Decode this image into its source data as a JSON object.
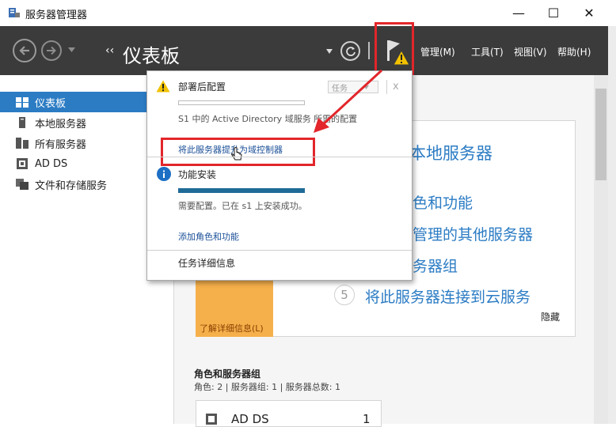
{
  "window": {
    "title": "服务器管理器",
    "controls": {
      "minimize": "—",
      "maximize": "☐",
      "close": "✕"
    }
  },
  "header": {
    "title": "仪表板",
    "breadcrumb_prefix": "‹‹",
    "menus": [
      "管理(M)",
      "工具(T)",
      "视图(V)",
      "帮助(H)"
    ]
  },
  "sidebar": {
    "items": [
      {
        "label": "仪表板",
        "icon": "dashboard-icon",
        "selected": true
      },
      {
        "label": "本地服务器",
        "icon": "server-icon"
      },
      {
        "label": "所有服务器",
        "icon": "servers-icon"
      },
      {
        "label": "AD DS",
        "icon": "ad-ds-icon"
      },
      {
        "label": "文件和存储服务",
        "icon": "storage-icon"
      }
    ]
  },
  "notifications": {
    "post_deploy": {
      "title": "部署后配置",
      "task_button": "任务",
      "description": "S1 中的 Active Directory 域服务 所需的配置",
      "link": "将此服务器提升为域控制器"
    },
    "feature_install": {
      "title": "功能安装",
      "description": "需要配置。已在 s1 上安装成功。",
      "link": "添加角色和功能"
    },
    "task_details": "任务详细信息"
  },
  "welcome": {
    "quick_start_visible": [
      "本地服务器",
      "色和功能",
      "管理的其他服务器",
      "务器组"
    ],
    "step5_number": "5",
    "step5_text": "将此服务器连接到云服务",
    "learn_more": "了解详细信息(L)",
    "hide": "隐藏"
  },
  "roles": {
    "title": "角色和服务器组",
    "summary": "角色: 2 | 服务器组: 1 | 服务器总数: 1",
    "tile_label": "AD DS",
    "tile_count": "1"
  },
  "colors": {
    "accent": "#2c7cc4",
    "header_bg": "#3b3b3b",
    "highlight_red": "#e2262b",
    "warning_yellow": "#f2c200",
    "orange_panel": "#f6b04b"
  }
}
